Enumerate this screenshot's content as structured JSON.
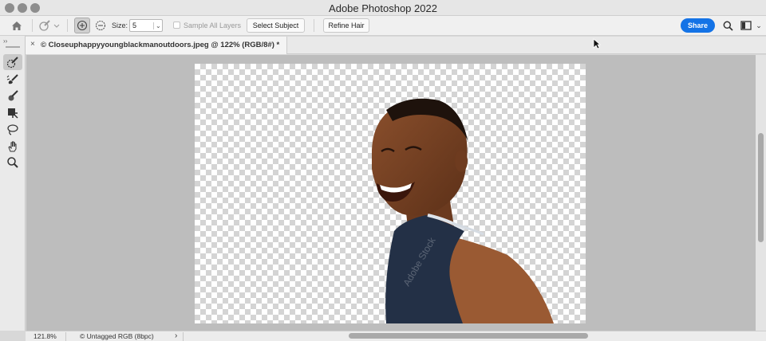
{
  "window": {
    "title": "Adobe Photoshop 2022"
  },
  "options_bar": {
    "size_label": "Size:",
    "size_value": "5",
    "sample_all_layers_label": "Sample All Layers",
    "sample_all_layers_checked": false,
    "select_subject_label": "Select Subject",
    "refine_hair_label": "Refine Hair",
    "share_label": "Share"
  },
  "document_tab": {
    "close_glyph": "×",
    "label": "© Closeuphappyyoungblackmanoutdoors.jpeg @ 122% (RGB/8#) *"
  },
  "tools": [
    {
      "name": "quick-selection-tool",
      "active": true
    },
    {
      "name": "brush-tool",
      "active": false
    },
    {
      "name": "color-brush-tool",
      "active": false
    },
    {
      "name": "object-selection-tool",
      "active": false
    },
    {
      "name": "lasso-tool",
      "active": false
    },
    {
      "name": "hand-tool",
      "active": false
    },
    {
      "name": "zoom-tool",
      "active": false
    }
  ],
  "status_bar": {
    "zoom": "121.8%",
    "profile": "© Untagged RGB (8bpc)",
    "arrow": "›"
  },
  "image_watermark": "Adobe Stock",
  "colors": {
    "accent": "#1473e6",
    "canvas_bg": "#bdbdbd"
  }
}
